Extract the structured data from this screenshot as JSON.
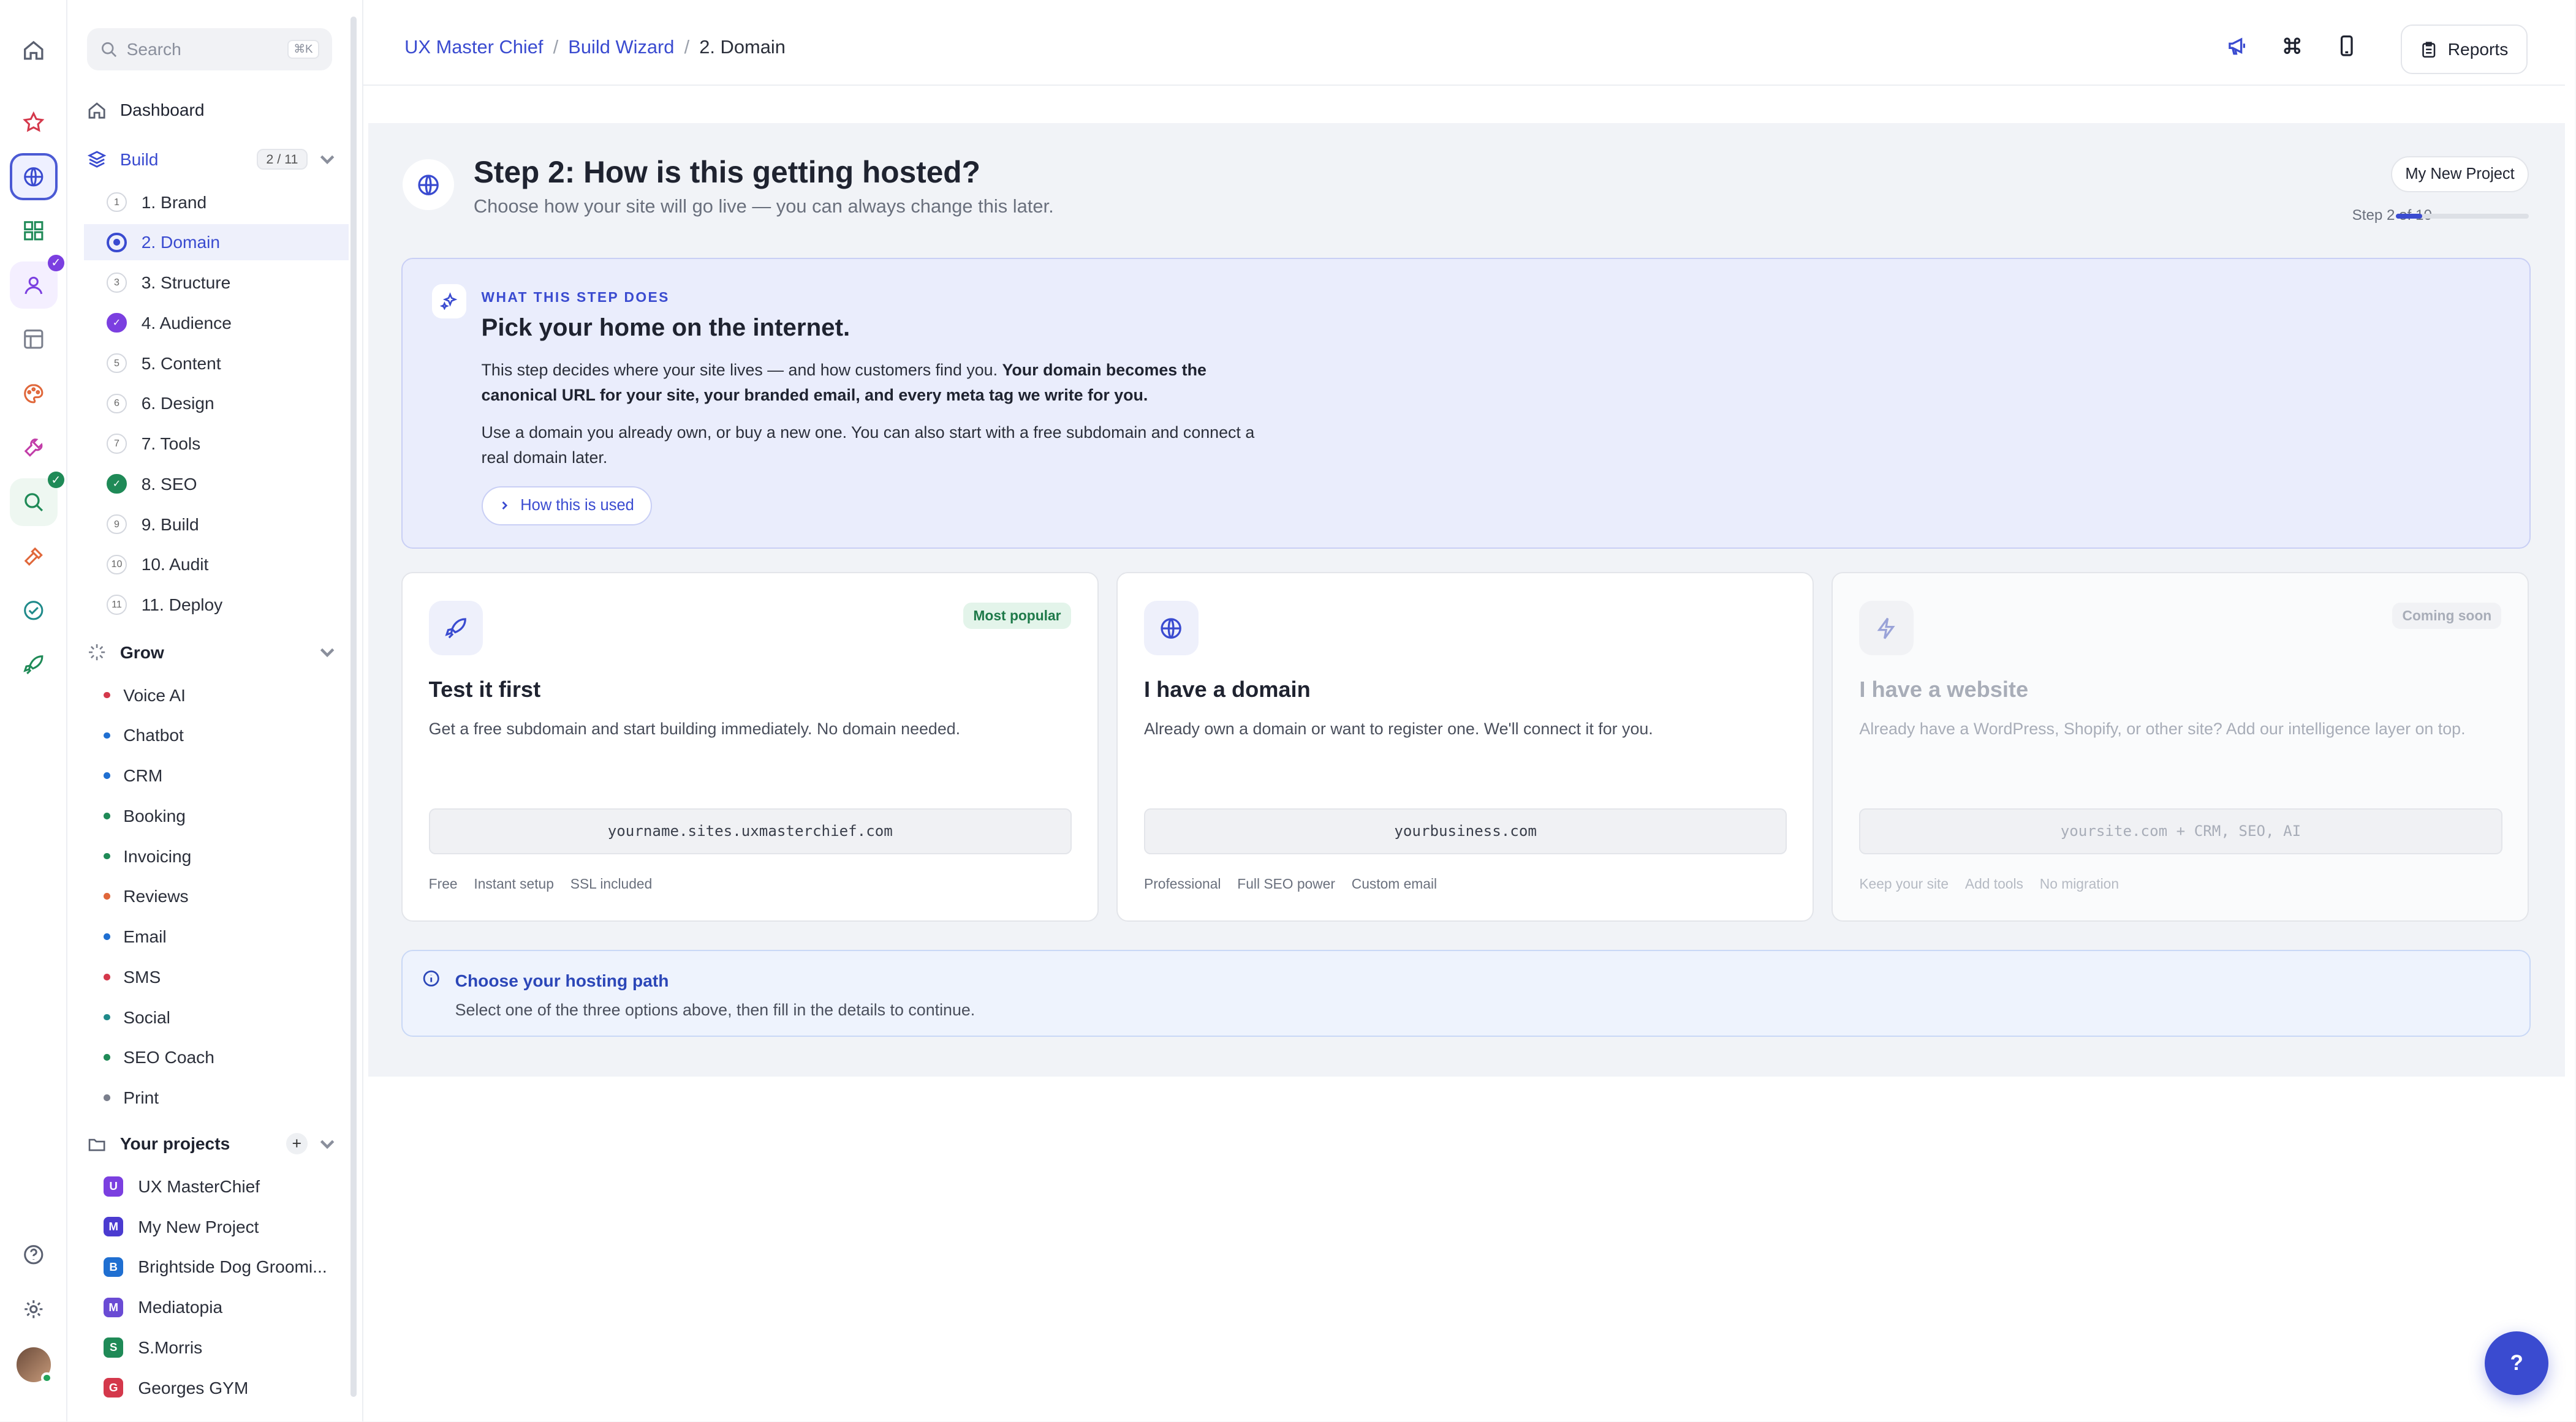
{
  "breadcrumbs": [
    "UX Master Chief",
    "Build Wizard",
    "2. Domain"
  ],
  "topbar": {
    "reports_label": "Reports"
  },
  "search": {
    "placeholder": "Search",
    "shortcut": "⌘K"
  },
  "sidebar": {
    "dashboard": "Dashboard",
    "build": {
      "label": "Build",
      "current": "2",
      "total": "11"
    },
    "steps": [
      {
        "num": "1",
        "label": "1. Brand",
        "state": "todo"
      },
      {
        "num": "2",
        "label": "2. Domain",
        "state": "current"
      },
      {
        "num": "3",
        "label": "3. Structure",
        "state": "todo"
      },
      {
        "num": "4",
        "label": "4. Audience",
        "state": "done-purple"
      },
      {
        "num": "5",
        "label": "5. Content",
        "state": "todo"
      },
      {
        "num": "6",
        "label": "6. Design",
        "state": "todo"
      },
      {
        "num": "7",
        "label": "7. Tools",
        "state": "todo"
      },
      {
        "num": "8",
        "label": "8. SEO",
        "state": "done-green"
      },
      {
        "num": "9",
        "label": "9. Build",
        "state": "todo"
      },
      {
        "num": "10",
        "label": "10. Audit",
        "state": "todo"
      },
      {
        "num": "11",
        "label": "11. Deploy",
        "state": "todo"
      }
    ],
    "grow": {
      "label": "Grow",
      "items": [
        {
          "label": "Voice AI",
          "color": "#d4384b"
        },
        {
          "label": "Chatbot",
          "color": "#1f6fd1"
        },
        {
          "label": "CRM",
          "color": "#1f6fd1"
        },
        {
          "label": "Booking",
          "color": "#1f8a57"
        },
        {
          "label": "Invoicing",
          "color": "#1f8a57"
        },
        {
          "label": "Reviews",
          "color": "#e0673a"
        },
        {
          "label": "Email",
          "color": "#1f6fd1"
        },
        {
          "label": "SMS",
          "color": "#d4384b"
        },
        {
          "label": "Social",
          "color": "#1f8a8a"
        },
        {
          "label": "SEO Coach",
          "color": "#1f8a57"
        },
        {
          "label": "Print",
          "color": "#7a7f8c"
        }
      ]
    },
    "projects": {
      "label": "Your projects",
      "items": [
        {
          "initial": "U",
          "label": "UX MasterChief",
          "color": "#7b3fe0"
        },
        {
          "initial": "M",
          "label": "My New Project",
          "color": "#4b3bd0"
        },
        {
          "initial": "B",
          "label": "Brightside Dog Groomi...",
          "color": "#1f6fd1"
        },
        {
          "initial": "M",
          "label": "Mediatopia",
          "color": "#6a4bd4"
        },
        {
          "initial": "S",
          "label": "S.Morris",
          "color": "#1f8a57"
        },
        {
          "initial": "G",
          "label": "Georges GYM",
          "color": "#d4384b"
        }
      ]
    }
  },
  "step": {
    "title": "Step 2: How is this getting hosted?",
    "subtitle": "Choose how your site will go live — you can always change this later.",
    "project_pill": "My New Project",
    "progress_label": "Step 2 of 10",
    "progress": 0.2
  },
  "info": {
    "eyebrow": "WHAT THIS STEP DOES",
    "title": "Pick your home on the internet.",
    "p1_plain": "This step decides where your site lives — and how customers find you. ",
    "p1_bold": "Your domain becomes the canonical URL for your site, your branded email, and every meta tag we write for you.",
    "p2": "Use a domain you already own, or buy a new one. You can also start with a free subdomain and connect a real domain later.",
    "how_label": "How this is used"
  },
  "options": [
    {
      "title": "Test it first",
      "badge": "Most popular",
      "desc": "Get a free subdomain and start building immediately. No domain needed.",
      "field": "yourname.sites.uxmasterchief.com",
      "tags": [
        "Free",
        "Instant setup",
        "SSL included"
      ]
    },
    {
      "title": "I have a domain",
      "badge": "",
      "desc": "Already own a domain or want to register one. We'll connect it for you.",
      "field": "yourbusiness.com",
      "tags": [
        "Professional",
        "Full SEO power",
        "Custom email"
      ]
    },
    {
      "title": "I have a website",
      "badge": "Coming soon",
      "desc": "Already have a WordPress, Shopify, or other site? Add our intelligence layer on top.",
      "field": "yoursite.com + CRM, SEO, AI",
      "tags": [
        "Keep your site",
        "Add tools",
        "No migration"
      ]
    }
  ],
  "hint": {
    "title": "Choose your hosting path",
    "subtitle": "Select one of the three options above, then fill in the details to continue."
  },
  "help_fab": "?"
}
